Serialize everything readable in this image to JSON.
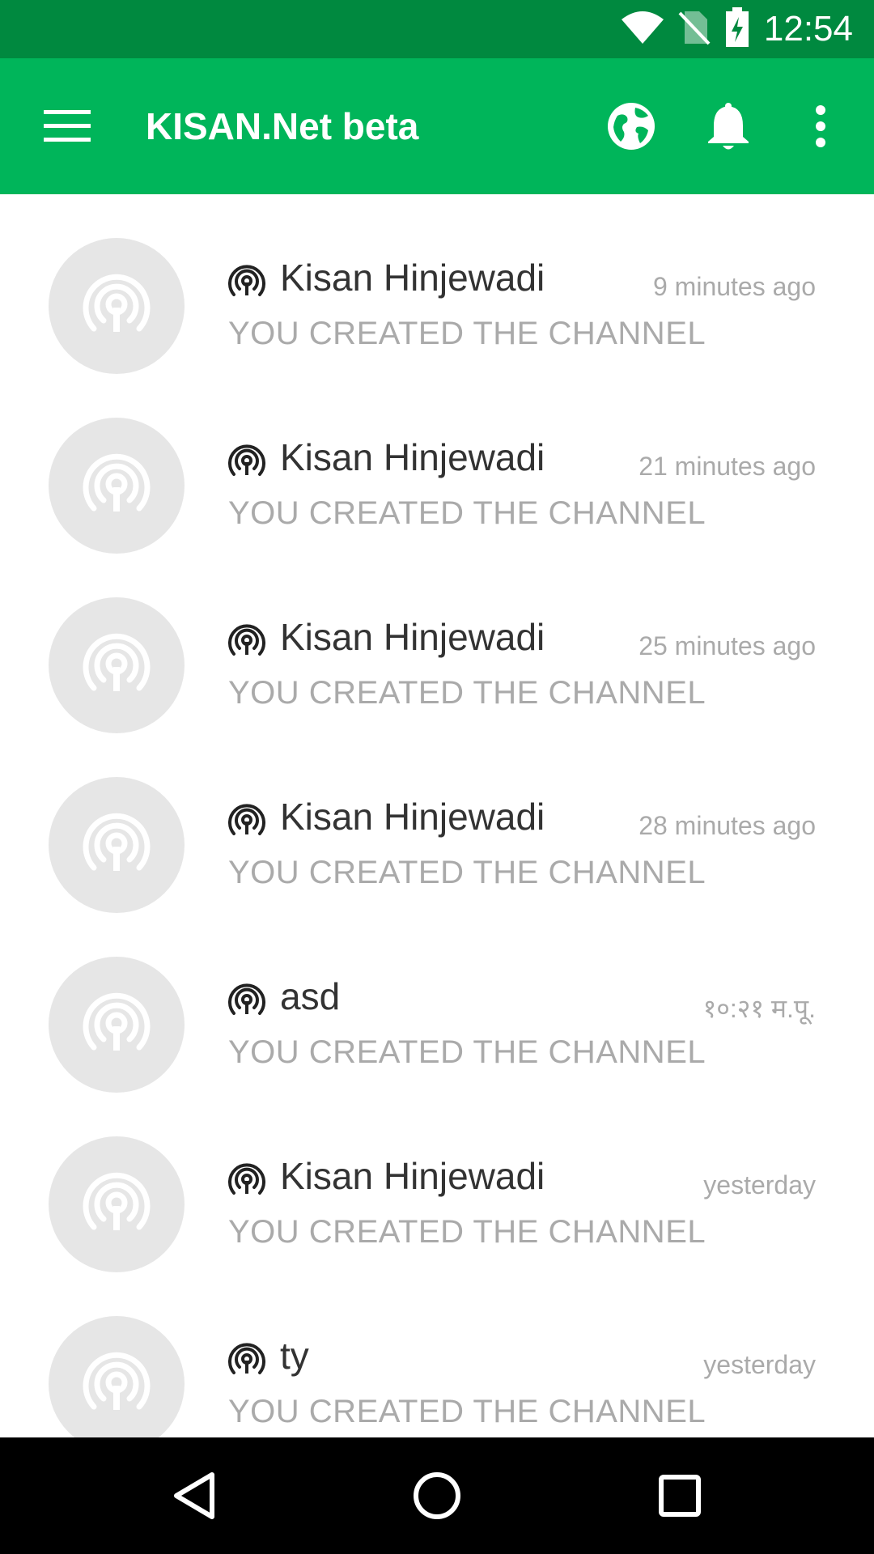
{
  "colors": {
    "status_bar": "#00893f",
    "app_bar": "#00b55a",
    "avatar_bg": "#e6e6e6",
    "primary_text": "#333333",
    "secondary_text": "#aaaaaa",
    "nav_bar": "#000000"
  },
  "status_bar": {
    "time": "12:54",
    "icons": [
      "wifi-icon",
      "no-sim-icon",
      "battery-charging-icon"
    ]
  },
  "app_bar": {
    "title": "KISAN.Net beta",
    "actions": [
      "globe-icon",
      "bell-icon",
      "overflow-menu-icon"
    ],
    "nav_icon": "hamburger-menu-icon"
  },
  "channels": [
    {
      "name": "Kisan Hinjewadi",
      "time": "9 minutes ago",
      "subtitle": "YOU CREATED THE CHANNEL"
    },
    {
      "name": "Kisan Hinjewadi",
      "time": "21 minutes ago",
      "subtitle": "YOU CREATED THE CHANNEL"
    },
    {
      "name": "Kisan Hinjewadi",
      "time": "25 minutes ago",
      "subtitle": "YOU CREATED THE CHANNEL"
    },
    {
      "name": "Kisan Hinjewadi",
      "time": "28 minutes ago",
      "subtitle": "YOU CREATED THE CHANNEL"
    },
    {
      "name": "asd",
      "time": "१०:२१ म.पू.",
      "subtitle": "YOU CREATED THE CHANNEL"
    },
    {
      "name": "Kisan Hinjewadi",
      "time": "yesterday",
      "subtitle": "YOU CREATED THE CHANNEL"
    },
    {
      "name": "ty",
      "time": "yesterday",
      "subtitle": "YOU CREATED THE CHANNEL"
    }
  ],
  "nav_bar": {
    "buttons": [
      "back-icon",
      "home-icon",
      "recents-icon"
    ]
  }
}
